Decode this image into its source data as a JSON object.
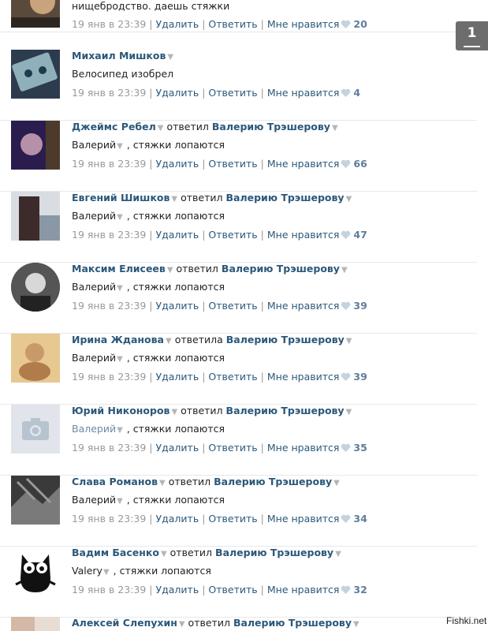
{
  "first_comment_tail": {
    "text": "нищебродство. даешь стяжки",
    "date": "19 янв в 23:39",
    "likes": "20"
  },
  "actions": {
    "delete": "Удалить",
    "reply": "Ответить",
    "like": "Мне нравится",
    "separator": "|"
  },
  "comments": [
    {
      "author": "Михаил Мишков",
      "reply_word": "",
      "reply_to": "",
      "mention": "",
      "text": "Велосипед изобрел",
      "date": "19 янв в 23:39",
      "likes": "4"
    },
    {
      "author": "Джеймс Ребел",
      "reply_word": "ответил",
      "reply_to": "Валерию Трэшерову",
      "mention": "Валерий",
      "text": ", стяжки лопаются",
      "date": "19 янв в 23:39",
      "likes": "66"
    },
    {
      "author": "Евгений Шишков",
      "reply_word": "ответил",
      "reply_to": "Валерию Трэшерову",
      "mention": "Валерий",
      "text": ", стяжки лопаются",
      "date": "19 янв в 23:39",
      "likes": "47"
    },
    {
      "author": "Максим Елисеев",
      "reply_word": "ответил",
      "reply_to": "Валерию Трэшерову",
      "mention": "Валерий",
      "text": ", стяжки лопаются",
      "date": "19 янв в 23:39",
      "likes": "39"
    },
    {
      "author": "Ирина Жданова",
      "reply_word": "ответила",
      "reply_to": "Валерию Трэшерову",
      "mention": "Валерий",
      "text": ", стяжки лопаются",
      "date": "19 янв в 23:39",
      "likes": "39"
    },
    {
      "author": "Юрий Никоноров",
      "reply_word": "ответил",
      "reply_to": "Валерию Трэшерову",
      "mention": "Валерий",
      "text": ", стяжки лопаются",
      "date": "19 янв в 23:39",
      "likes": "35"
    },
    {
      "author": "Слава Романов",
      "reply_word": "ответил",
      "reply_to": "Валерию Трэшерову",
      "mention": "Валерий",
      "text": ", стяжки лопаются",
      "date": "19 янв в 23:39",
      "likes": "34"
    },
    {
      "author": "Вадим Басенко",
      "reply_word": "ответил",
      "reply_to": "Валерию Трэшерову",
      "mention": "Valery",
      "text": ", стяжки лопаются",
      "date": "19 янв в 23:39",
      "likes": "32"
    },
    {
      "author": "Алексей Слепухин",
      "reply_word": "ответил",
      "reply_to": "Валерию Трэшерову",
      "mention": "",
      "text": "",
      "date": "",
      "likes": ""
    }
  ],
  "page_badge": "1",
  "watermark": "Fishki.net",
  "colors": {
    "name": "#2b587a",
    "meta": "#999999",
    "likes": "#5f7d9c",
    "divider": "#e7e8ec"
  }
}
